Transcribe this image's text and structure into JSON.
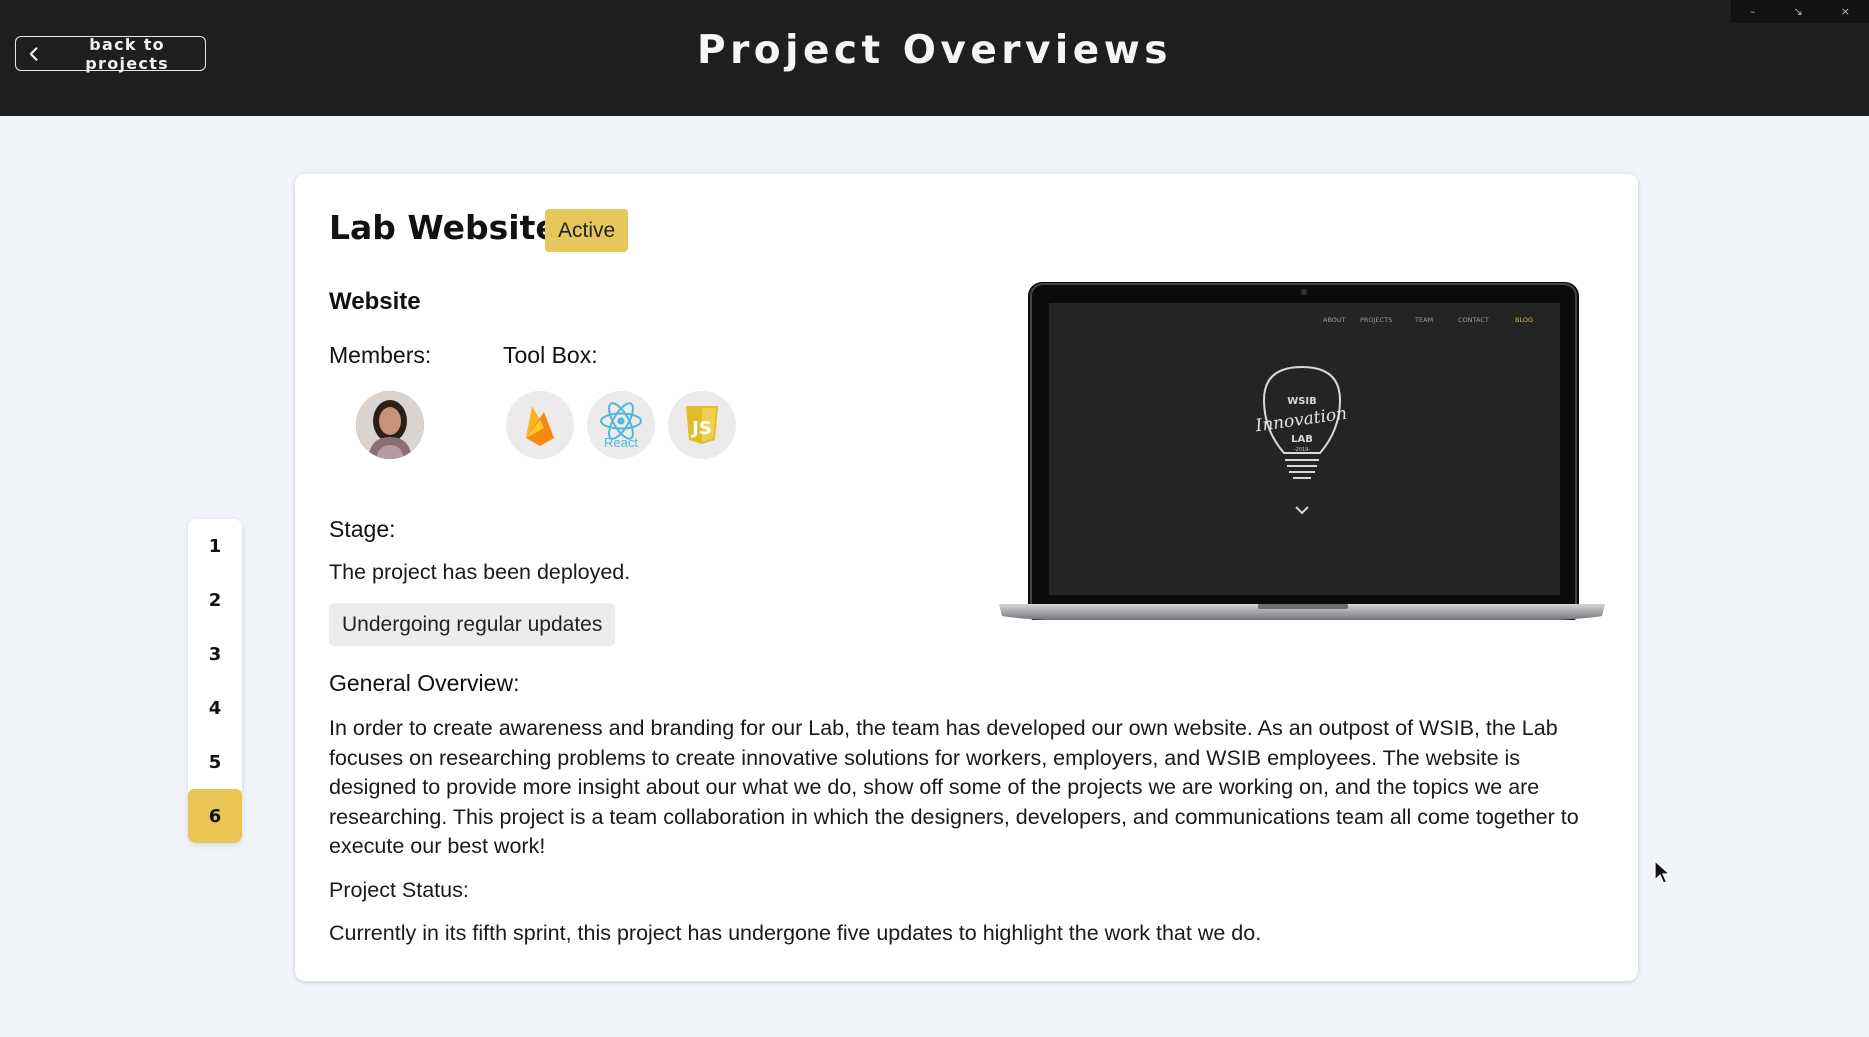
{
  "header": {
    "back_label": "back to projects",
    "title": "Project Overviews"
  },
  "pager": {
    "pages": [
      "1",
      "2",
      "3",
      "4",
      "5",
      "6"
    ],
    "active": "6"
  },
  "project": {
    "name": "Lab Website",
    "status": "Active",
    "category": "Website",
    "members_label": "Members:",
    "toolbox_label": "Tool Box:",
    "tools": [
      "firebase-icon",
      "react-icon",
      "javascript-icon"
    ],
    "react_caption": "React",
    "stage_label": "Stage:",
    "stage_text": "The project has been deployed.",
    "update_tag": "Undergoing regular updates",
    "overview_label": "General Overview:",
    "overview_text": "In order to create awareness and branding for our Lab, the team has developed our own website. As an outpost of WSIB, the Lab focuses on researching problems to create innovative solutions for workers, employers, and WSIB employees. The website is designed to provide more insight about our what we do, show off some of the projects we are working on, and the topics we are researching. This project is a team collaboration in which the designers, developers, and communications team all come together to execute our best work!",
    "project_status_label": "Project Status:",
    "project_status_text": "Currently in its fifth sprint, this project has undergone five updates to highlight the work that we do."
  },
  "screen_preview": {
    "nav": [
      "ABOUT",
      "PROJECTS",
      "TEAM",
      "CONTACT",
      "BLOG"
    ],
    "logo_top": "WSIB",
    "logo_script": "Innovation",
    "logo_lab": "LAB",
    "logo_year": "-2019-"
  },
  "colors": {
    "accent": "#e9c554",
    "header_bg": "#1e1e1e",
    "page_bg": "#f1f4f8"
  }
}
